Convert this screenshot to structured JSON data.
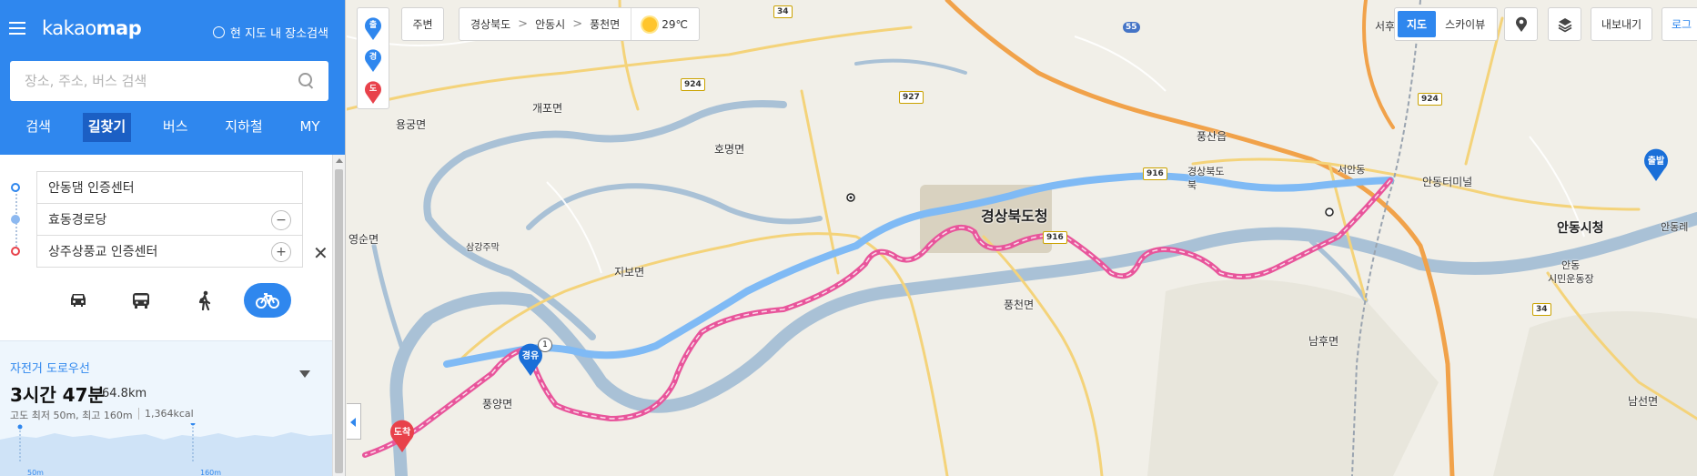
{
  "app": {
    "logo_text": "kakao",
    "logo_bold": "map",
    "area_search_label": "현 지도 내 장소검색"
  },
  "search": {
    "placeholder": "장소, 주소, 버스 검색",
    "value": ""
  },
  "nav_tabs": [
    {
      "label": "검색",
      "active": false
    },
    {
      "label": "길찾기",
      "active": true
    },
    {
      "label": "버스",
      "active": false
    },
    {
      "label": "지하철",
      "active": false
    },
    {
      "label": "MY",
      "active": false
    }
  ],
  "route": {
    "start": "안동댐 인증센터",
    "via": "효동경로당",
    "end": "상주상풍교 인증센터",
    "remove_via_symbol": "−",
    "add_via_symbol": "+",
    "close_symbol": "✕",
    "modes": [
      {
        "icon": "car-icon",
        "active": false
      },
      {
        "icon": "bus-icon",
        "active": false
      },
      {
        "icon": "walk-icon",
        "active": false
      },
      {
        "icon": "bicycle-icon",
        "active": true
      }
    ]
  },
  "result": {
    "route_type": "자전거 도로우선",
    "duration": "3시간 47분",
    "distance": "64.8km",
    "elevation": "고도 최저 50m, 최고 160m",
    "calories": "1,364kcal",
    "graph_labels": [
      "50m",
      "160m"
    ]
  },
  "map": {
    "quick_pins": [
      {
        "label": "출",
        "color": "#2f87ee"
      },
      {
        "label": "경",
        "color": "#2f87ee"
      },
      {
        "label": "도",
        "color": "#e8424b"
      }
    ],
    "nearby_label": "주변",
    "breadcrumb": [
      "경상북도",
      "안동시",
      "풍천면"
    ],
    "weather": "29℃",
    "map_type": [
      "지도",
      "스카이뷰"
    ],
    "export_label": "내보내기",
    "login_label": "로그",
    "markers": {
      "start": "출발",
      "via": "경유",
      "via_number": "1",
      "end": "도착"
    },
    "place_labels": [
      "용궁면",
      "개포면",
      "호명면",
      "지보면",
      "풍천면",
      "풍산읍",
      "서안동",
      "안동터미널",
      "안동시청",
      "안동",
      "시민운동장",
      "남후면",
      "남선면",
      "영순면",
      "삼강주막",
      "풍양면",
      "경상북도청",
      "면",
      "서후",
      "안동레",
      "경상북도",
      "북"
    ],
    "road_shields": [
      "34",
      "924",
      "927",
      "916",
      "55",
      "924",
      "34",
      "916"
    ],
    "colors": {
      "accent": "#2f87ee",
      "route_bike": "#e8559b",
      "route_road": "#7fbaf5",
      "start": "#2f87ee",
      "end": "#e8424b"
    }
  }
}
